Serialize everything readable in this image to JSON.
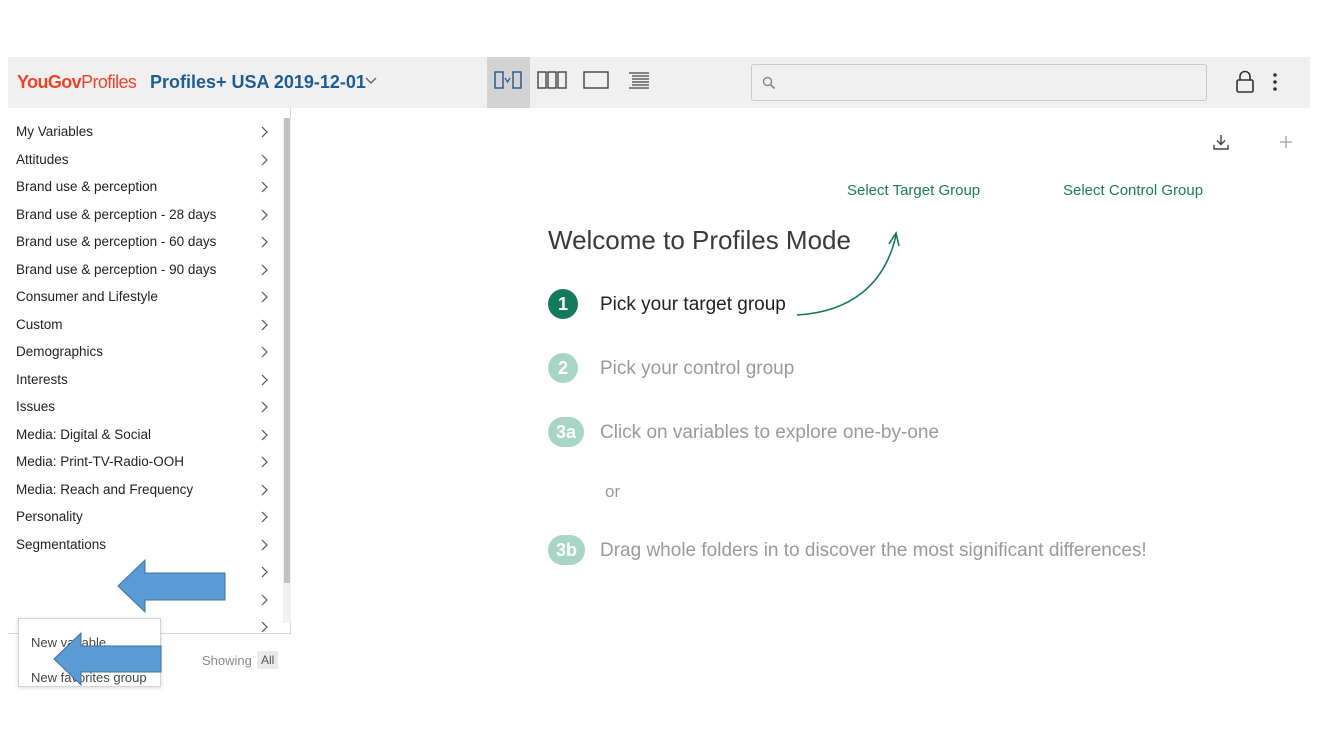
{
  "header": {
    "logo_bold": "YouGov",
    "logo_light": "Profiles",
    "dataset": "Profiles+ USA 2019-12-01",
    "search_placeholder": "",
    "icons": [
      "chevron-down-icon",
      "compare-view-icon",
      "columns-view-icon",
      "single-view-icon",
      "list-view-icon",
      "search-icon",
      "lock-icon",
      "kebab-menu-icon"
    ]
  },
  "sidebar": {
    "categories": [
      "My Variables",
      "Attitudes",
      "Brand use & perception",
      "Brand use & perception - 28 days",
      "Brand use & perception - 60 days",
      "Brand use & perception - 90 days",
      "Consumer and Lifestyle",
      "Custom",
      "Demographics",
      "Interests",
      "Issues",
      "Media: Digital & Social",
      "Media: Print-TV-Radio-OOH",
      "Media: Reach and Frequency",
      "Personality",
      "Segmentations"
    ],
    "showing_label": "Showing",
    "showing_value": "All"
  },
  "popup_menu": {
    "items": [
      "New variable",
      "New favorites group"
    ]
  },
  "main": {
    "select_target": "Select Target Group",
    "select_control": "Select Control Group",
    "welcome_title": "Welcome to Profiles Mode",
    "steps": [
      {
        "badge": "1",
        "text": "Pick your target group",
        "active": true
      },
      {
        "badge": "2",
        "text": "Pick your control group",
        "active": false
      },
      {
        "badge": "3a",
        "text": "Click on variables to explore one-by-one",
        "active": false
      },
      {
        "badge": "3b",
        "text": "Drag whole folders in to discover the most significant differences!",
        "active": false
      }
    ],
    "or_label": "or"
  },
  "colors": {
    "brand_red": "#e8452c",
    "dataset_blue": "#1e5d91",
    "link_green": "#1f7a57",
    "step_active": "#157a5c",
    "step_inactive": "#a8d5c6",
    "annotation_arrow": "#5b9bd5"
  }
}
